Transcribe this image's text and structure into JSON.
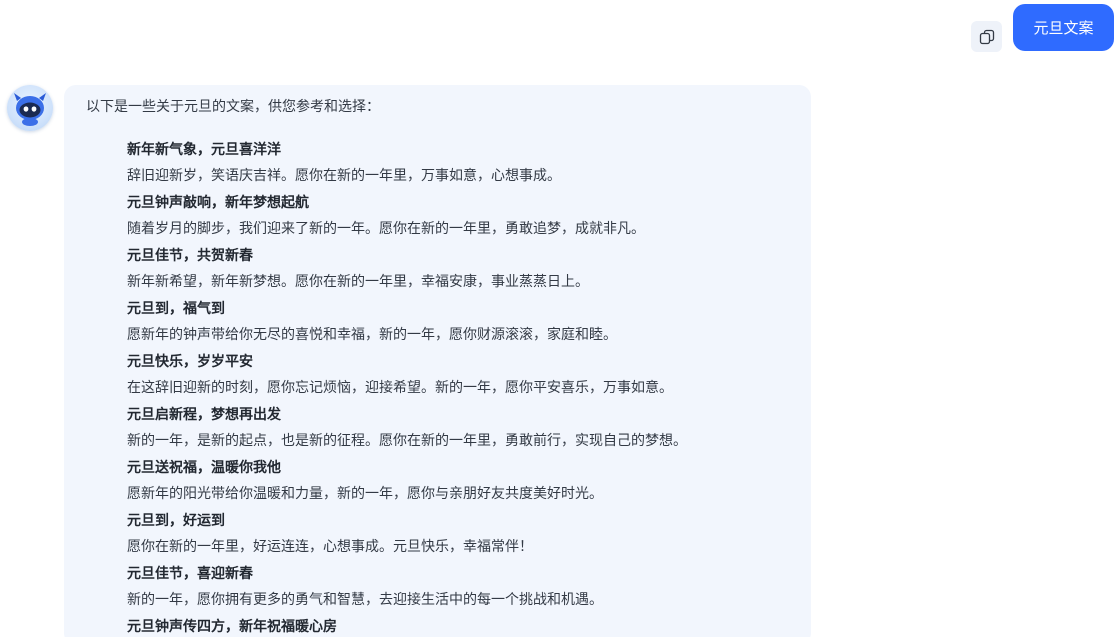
{
  "user_message": {
    "text": "元旦文案"
  },
  "toolbar": {
    "copy_icon": "copy-icon"
  },
  "assistant": {
    "avatar_icon": "robot-avatar-icon",
    "intro": "以下是一些关于元旦的文案，供您参考和选择：",
    "entries": [
      {
        "title": "新年新气象，元旦喜洋洋",
        "body": "辞旧迎新岁，笑语庆吉祥。愿你在新的一年里，万事如意，心想事成。"
      },
      {
        "title": "元旦钟声敲响，新年梦想起航",
        "body": "随着岁月的脚步，我们迎来了新的一年。愿你在新的一年里，勇敢追梦，成就非凡。"
      },
      {
        "title": "元旦佳节，共贺新春",
        "body": "新年新希望，新年新梦想。愿你在新的一年里，幸福安康，事业蒸蒸日上。"
      },
      {
        "title": "元旦到，福气到",
        "body": "愿新年的钟声带给你无尽的喜悦和幸福，新的一年，愿你财源滚滚，家庭和睦。"
      },
      {
        "title": "元旦快乐，岁岁平安",
        "body": "在这辞旧迎新的时刻，愿你忘记烦恼，迎接希望。新的一年，愿你平安喜乐，万事如意。"
      },
      {
        "title": "元旦启新程，梦想再出发",
        "body": "新的一年，是新的起点，也是新的征程。愿你在新的一年里，勇敢前行，实现自己的梦想。"
      },
      {
        "title": "元旦送祝福，温暖你我他",
        "body": "愿新年的阳光带给你温暖和力量，新的一年，愿你与亲朋好友共度美好时光。"
      },
      {
        "title": "元旦到，好运到",
        "body": "愿你在新的一年里，好运连连，心想事成。元旦快乐，幸福常伴！"
      },
      {
        "title": "元旦佳节，喜迎新春",
        "body": "新的一年，愿你拥有更多的勇气和智慧，去迎接生活中的每一个挑战和机遇。"
      },
      {
        "title": "元旦钟声传四方，新年祝福暖心房",
        "body": ""
      }
    ]
  }
}
